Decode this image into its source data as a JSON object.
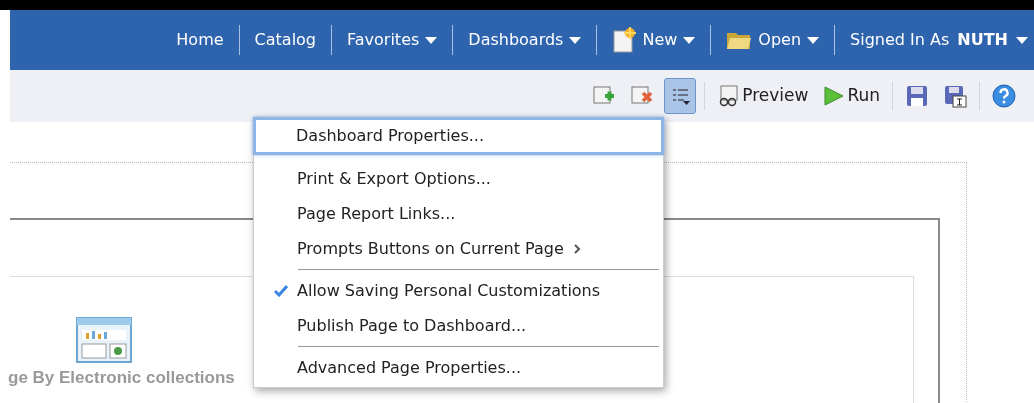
{
  "nav": [
    {
      "label": "Home",
      "dropdown": false,
      "kind": "link"
    },
    {
      "label": "Catalog",
      "dropdown": false,
      "kind": "link"
    },
    {
      "label": "Favorites",
      "dropdown": true,
      "kind": "link"
    },
    {
      "label": "Dashboards",
      "dropdown": true,
      "kind": "link"
    },
    {
      "label": "New",
      "dropdown": true,
      "kind": "new"
    },
    {
      "label": "Open",
      "dropdown": true,
      "kind": "open"
    }
  ],
  "user": {
    "label": "Signed In As",
    "name": "NUTH"
  },
  "toolbar": [
    {
      "kind": "add",
      "selected": false
    },
    {
      "kind": "delete",
      "selected": false
    },
    {
      "kind": "properties",
      "selected": true
    },
    {
      "kind": "preview",
      "label": "Preview",
      "selected": false
    },
    {
      "kind": "run",
      "label": "Run",
      "selected": false
    },
    {
      "kind": "save",
      "selected": false
    },
    {
      "kind": "save-as",
      "selected": false
    },
    {
      "kind": "help",
      "selected": false
    }
  ],
  "menu": [
    [
      {
        "label": "Dashboard Properties...",
        "highlighted": true,
        "checked": false,
        "submenu": false
      }
    ],
    [
      {
        "label": "Print & Export Options...",
        "highlighted": false,
        "checked": false,
        "submenu": false
      },
      {
        "label": "Page Report Links...",
        "highlighted": false,
        "checked": false,
        "submenu": false
      },
      {
        "label": "Prompts Buttons on Current Page",
        "highlighted": false,
        "checked": false,
        "submenu": true
      }
    ],
    [
      {
        "label": "Allow Saving Personal Customizations",
        "highlighted": false,
        "checked": true,
        "submenu": false
      },
      {
        "label": "Publish Page to Dashboard...",
        "highlighted": false,
        "checked": false,
        "submenu": false
      }
    ],
    [
      {
        "label": "Advanced Page Properties...",
        "highlighted": false,
        "checked": false,
        "submenu": false
      }
    ]
  ],
  "content": {
    "caption": "ge By Electronic collections"
  }
}
